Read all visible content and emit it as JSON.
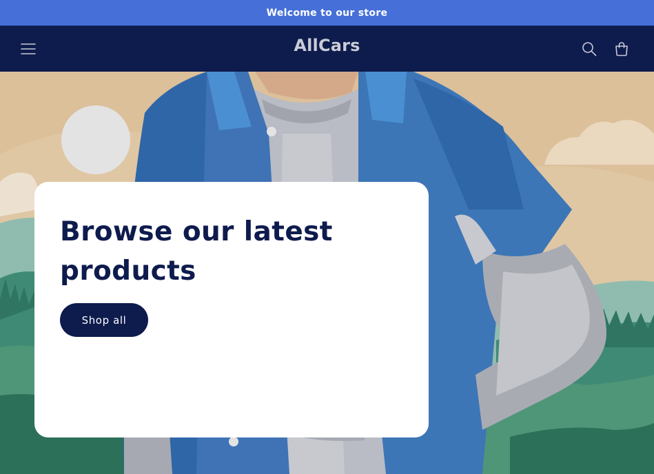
{
  "announcement": {
    "text": "Welcome to our store"
  },
  "header": {
    "logo_text": "AllCars",
    "menu_icon": "hamburger-menu-icon",
    "search_icon": "search-icon",
    "cart_icon": "cart-icon"
  },
  "hero": {
    "title": "Browse our latest products",
    "button_label": "Shop all",
    "image_subject": "illustration-person-denim-jacket"
  },
  "colors": {
    "announcement_bg": "#4670d8",
    "header_bg": "#0e1b4d",
    "logo_text": "#c9ccd6",
    "brand_navy": "#0e1b4d",
    "card_bg": "#ffffff"
  }
}
